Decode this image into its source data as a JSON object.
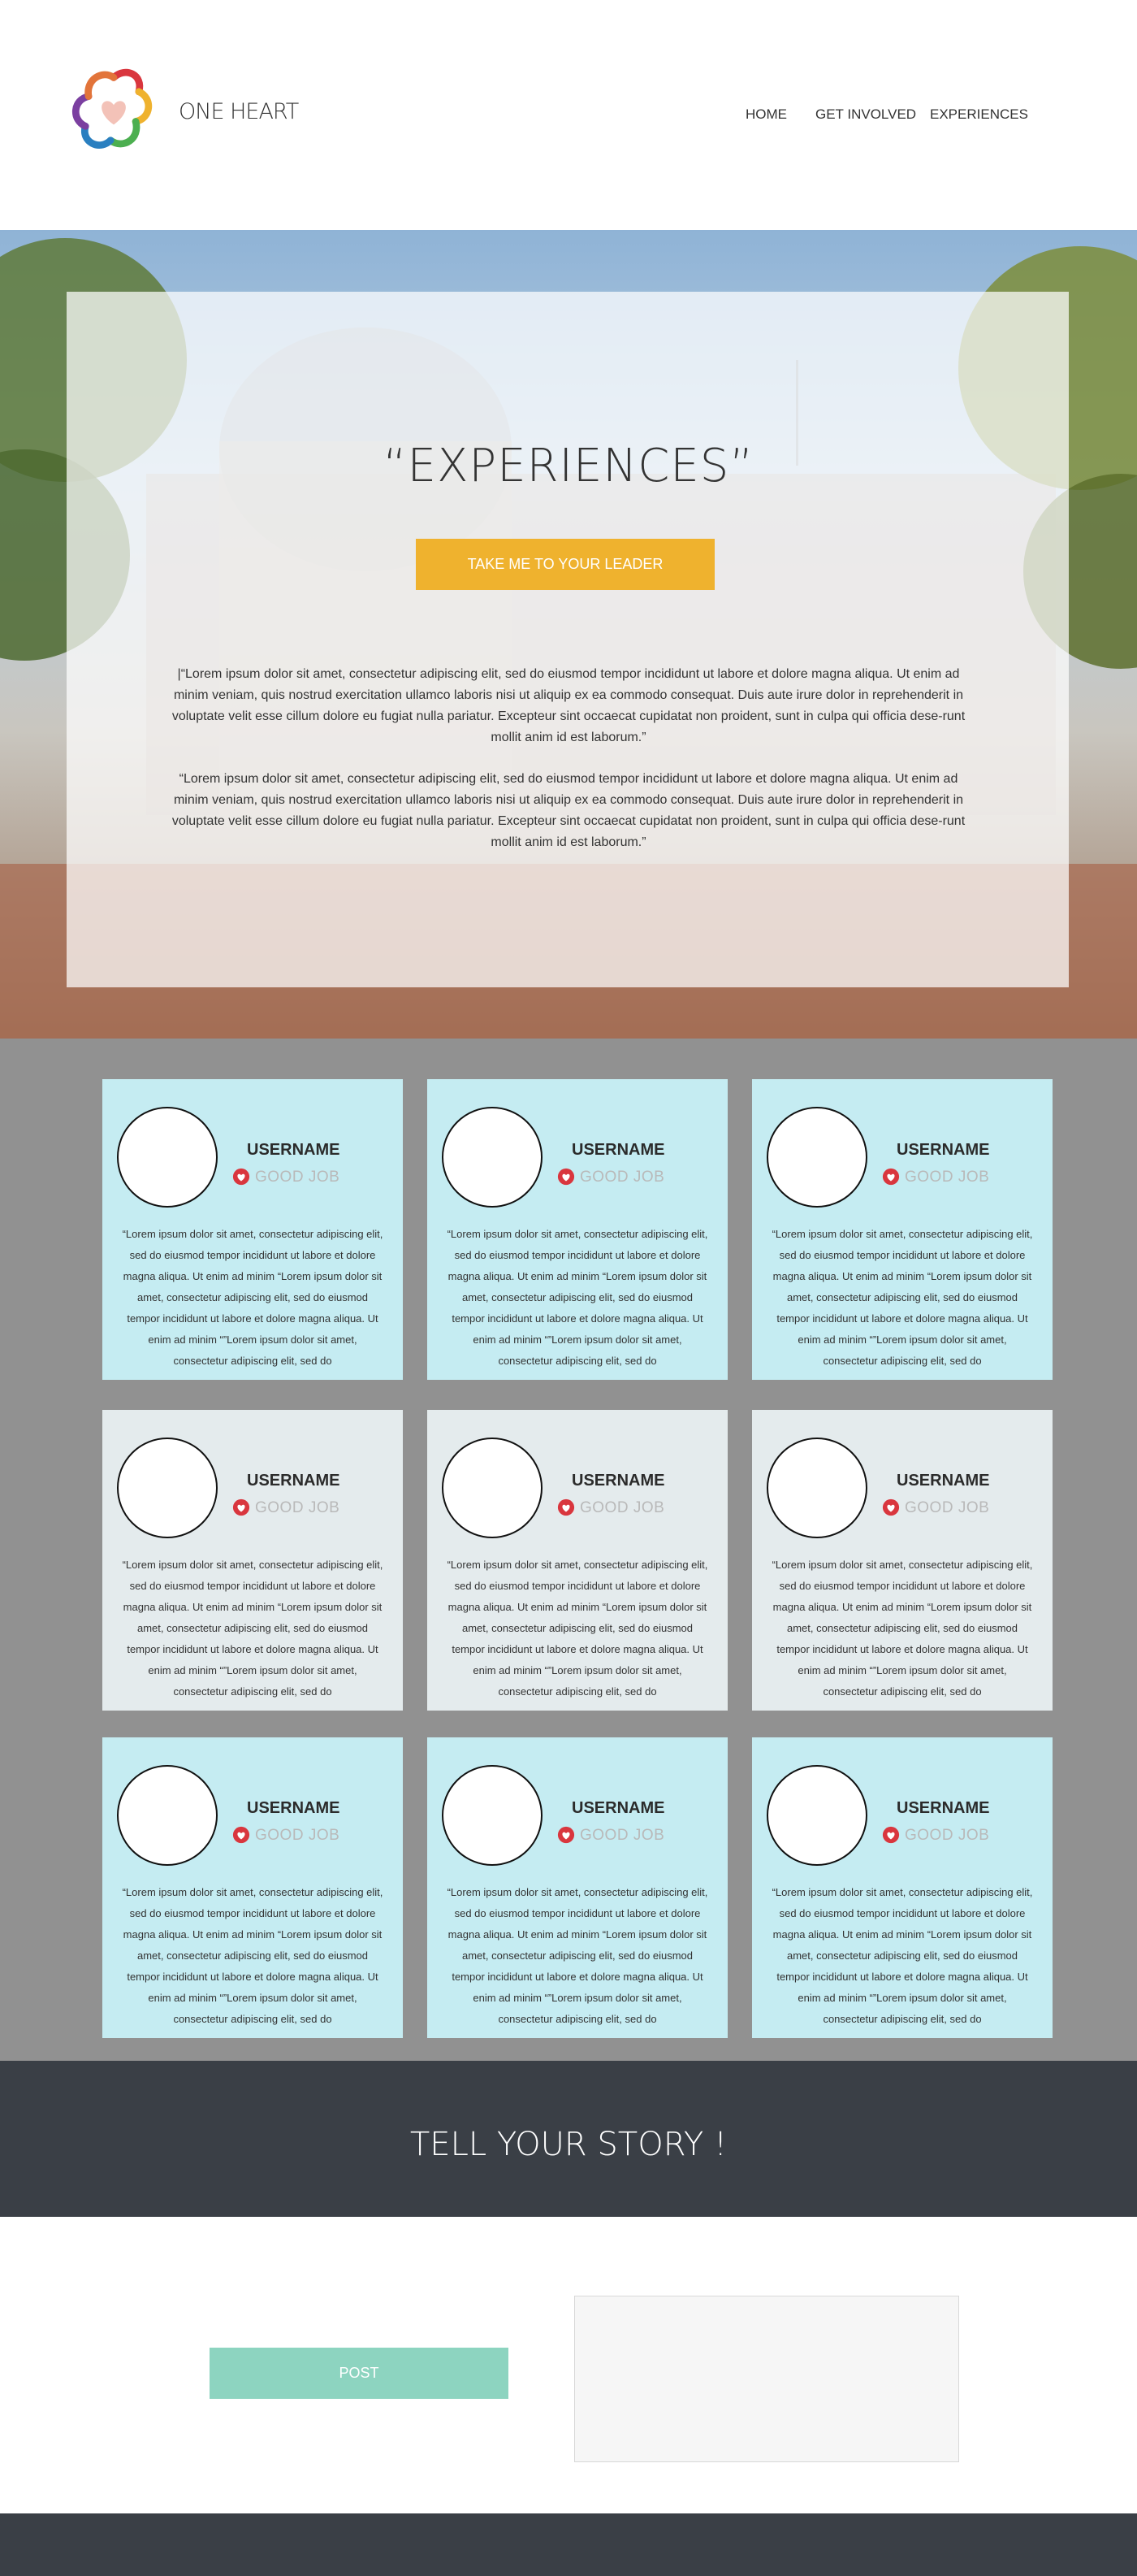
{
  "header": {
    "brand": "ONE HEART",
    "nav": [
      "HOME",
      "GET INVOLVED",
      "EXPERIENCES"
    ]
  },
  "hero": {
    "title": "“EXPERIENCES”",
    "button": "TAKE ME TO YOUR LEADER",
    "paragraphs": [
      "|“Lorem ipsum dolor sit amet, consectetur adipiscing elit, sed do eiusmod tempor incididunt ut labore et dolore magna aliqua. Ut enim ad minim veniam, quis nostrud exercitation ullamco laboris nisi ut aliquip ex ea commodo consequat. Duis aute irure dolor in reprehenderit in voluptate velit esse cillum dolore eu fugiat nulla pariatur. Excepteur sint occaecat cupidatat non proident, sunt in culpa qui officia dese-runt mollit anim id est laborum.”",
      "“Lorem ipsum dolor sit amet, consectetur adipiscing elit, sed do eiusmod tempor incididunt ut labore et dolore magna aliqua. Ut enim ad minim veniam, quis nostrud exercitation ullamco laboris nisi ut aliquip ex ea commodo consequat. Duis aute irure dolor in reprehenderit in voluptate velit esse cillum dolore eu fugiat nulla pariatur. Excepteur sint occaecat cupidatat non proident, sunt in culpa qui officia dese-runt mollit anim id est laborum.”"
    ]
  },
  "cards": [
    {
      "username": "USERNAME",
      "badge": "GOOD JOB",
      "text": "“Lorem ipsum dolor sit amet, consectetur adipiscing elit, sed do eiusmod tempor incididunt ut labore et dolore magna aliqua. Ut enim ad minim “Lorem ipsum dolor sit amet, consectetur adipiscing elit, sed do eiusmod tempor incididunt ut labore et dolore magna aliqua. Ut enim ad minim “”Lorem ipsum dolor sit amet, consectetur adipiscing elit, sed do",
      "color": "blue"
    },
    {
      "username": "USERNAME",
      "badge": "GOOD JOB",
      "text": "“Lorem ipsum dolor sit amet, consectetur adipiscing elit, sed do eiusmod tempor incididunt ut labore et dolore magna aliqua. Ut enim ad minim “Lorem ipsum dolor sit amet, consectetur adipiscing elit, sed do eiusmod tempor incididunt ut labore et dolore magna aliqua. Ut enim ad minim “”Lorem ipsum dolor sit amet, consectetur adipiscing elit, sed do",
      "color": "blue"
    },
    {
      "username": "USERNAME",
      "badge": "GOOD JOB",
      "text": "“Lorem ipsum dolor sit amet, consectetur adipiscing elit, sed do eiusmod tempor incididunt ut labore et dolore magna aliqua. Ut enim ad minim “Lorem ipsum dolor sit amet, consectetur adipiscing elit, sed do eiusmod tempor incididunt ut labore et dolore magna aliqua. Ut enim ad minim “”Lorem ipsum dolor sit amet, consectetur adipiscing elit, sed do",
      "color": "blue"
    },
    {
      "username": "USERNAME",
      "badge": "GOOD JOB",
      "text": "“Lorem ipsum dolor sit amet, consectetur adipiscing elit, sed do eiusmod tempor incididunt ut labore et dolore magna aliqua. Ut enim ad minim “Lorem ipsum dolor sit amet, consectetur adipiscing elit, sed do eiusmod tempor incididunt ut labore et dolore magna aliqua. Ut enim ad minim “”Lorem ipsum dolor sit amet, consectetur adipiscing elit, sed do",
      "color": "gray"
    },
    {
      "username": "USERNAME",
      "badge": "GOOD JOB",
      "text": "“Lorem ipsum dolor sit amet, consectetur adipiscing elit, sed do eiusmod tempor incididunt ut labore et dolore magna aliqua. Ut enim ad minim “Lorem ipsum dolor sit amet, consectetur adipiscing elit, sed do eiusmod tempor incididunt ut labore et dolore magna aliqua. Ut enim ad minim “”Lorem ipsum dolor sit amet, consectetur adipiscing elit, sed do",
      "color": "gray"
    },
    {
      "username": "USERNAME",
      "badge": "GOOD JOB",
      "text": "“Lorem ipsum dolor sit amet, consectetur adipiscing elit, sed do eiusmod tempor incididunt ut labore et dolore magna aliqua. Ut enim ad minim “Lorem ipsum dolor sit amet, consectetur adipiscing elit, sed do eiusmod tempor incididunt ut labore et dolore magna aliqua. Ut enim ad minim “”Lorem ipsum dolor sit amet, consectetur adipiscing elit, sed do",
      "color": "gray"
    },
    {
      "username": "USERNAME",
      "badge": "GOOD JOB",
      "text": "“Lorem ipsum dolor sit amet, consectetur adipiscing elit, sed do eiusmod tempor incididunt ut labore et dolore magna aliqua. Ut enim ad minim “Lorem ipsum dolor sit amet, consectetur adipiscing elit, sed do eiusmod tempor incididunt ut labore et dolore magna aliqua. Ut enim ad minim “”Lorem ipsum dolor sit amet, consectetur adipiscing elit, sed do",
      "color": "blue"
    },
    {
      "username": "USERNAME",
      "badge": "GOOD JOB",
      "text": "“Lorem ipsum dolor sit amet, consectetur adipiscing elit, sed do eiusmod tempor incididunt ut labore et dolore magna aliqua. Ut enim ad minim “Lorem ipsum dolor sit amet, consectetur adipiscing elit, sed do eiusmod tempor incididunt ut labore et dolore magna aliqua. Ut enim ad minim “”Lorem ipsum dolor sit amet, consectetur adipiscing elit, sed do",
      "color": "blue"
    },
    {
      "username": "USERNAME",
      "badge": "GOOD JOB",
      "text": "“Lorem ipsum dolor sit amet, consectetur adipiscing elit, sed do eiusmod tempor incididunt ut labore et dolore magna aliqua. Ut enim ad minim “Lorem ipsum dolor sit amet, consectetur adipiscing elit, sed do eiusmod tempor incididunt ut labore et dolore magna aliqua. Ut enim ad minim “”Lorem ipsum dolor sit amet, consectetur adipiscing elit, sed do",
      "color": "blue"
    }
  ],
  "story": {
    "title": "TELL YOUR STORY !"
  },
  "post": {
    "button": "POST"
  },
  "colors": {
    "accent": "#efb22e",
    "post": "#8dd4c0",
    "card_blue": "#c5ecf2",
    "card_gray": "#e4ebed",
    "dark": "#3a3f46",
    "heart": "#d9363e"
  },
  "icons": {
    "logo": "heart-flower-logo-icon",
    "badge": "heart-icon"
  }
}
